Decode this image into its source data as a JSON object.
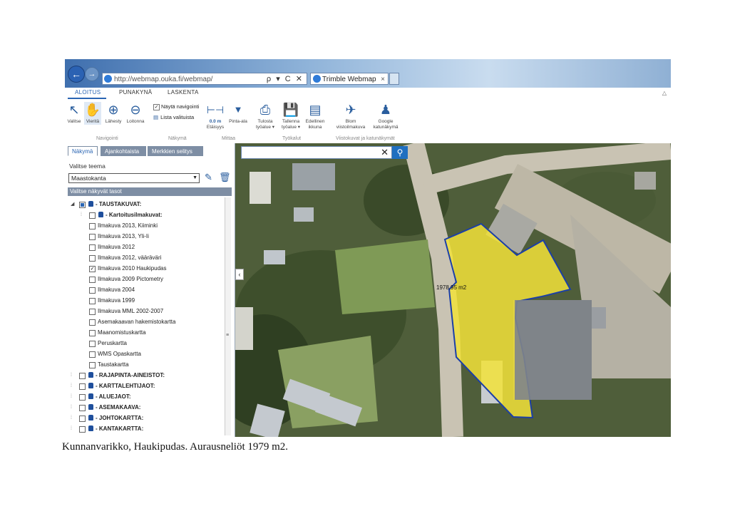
{
  "browser": {
    "url": "http://webmap.ouka.fi/webmap/",
    "tab_title": "Trimble Webmap",
    "tab_close": "×",
    "address_tools": "ρ ▾ C ✕"
  },
  "ribbon": {
    "tabs": [
      "ALOITUS",
      "PUNAKYNÄ",
      "LASKENTA"
    ],
    "navigointi": [
      "Valitse",
      "Vieritä",
      "Lähesty",
      "Loitonna"
    ],
    "nakyma_checks": [
      "Näytä navigointi",
      "Lista valituista"
    ],
    "mittaa": [
      "Etäisyys",
      "Pinta-ala"
    ],
    "etaisyys_value": "0.0 m",
    "pinta_ala_icon": "m²",
    "tyokalut": [
      "Tulosta työalue ▾",
      "Tallenna työalue ▾",
      "Edellinen ikkuna"
    ],
    "viistokuvat": [
      "Blom viistoilmakuva",
      "Google katunäkymä"
    ],
    "group_labels": [
      "Navigointi",
      "Näkymä",
      "Mittaa",
      "Työkalut",
      "Viistokuvat ja katunäkymät"
    ]
  },
  "panel": {
    "tabs": [
      "Näkymä",
      "Ajankohtaista",
      "Merkkien selitys"
    ],
    "theme_label": "Valitse teema",
    "theme_value": "Maastokanta",
    "layers_header": "Valitse näkyvät tasot",
    "tree": [
      {
        "label": "- TAUSTAKUVAT:",
        "level": 0,
        "expand": "◢",
        "checked": "partial",
        "lock": true,
        "bold": true
      },
      {
        "label": "- Kartoitusilmakuvat:",
        "level": 1,
        "expand": "",
        "checked": false,
        "lock": true,
        "bold": true
      },
      {
        "label": "Ilmakuva 2013, Kiiminki",
        "level": 2,
        "checked": false
      },
      {
        "label": "Ilmakuva 2013, Yli-Ii",
        "level": 2,
        "checked": false
      },
      {
        "label": "Ilmakuva 2012",
        "level": 2,
        "checked": false
      },
      {
        "label": "Ilmakuva 2012, vääräväri",
        "level": 2,
        "checked": false
      },
      {
        "label": "Ilmakuva 2010 Haukipudas",
        "level": 2,
        "checked": true
      },
      {
        "label": "Ilmakuva 2009 Pictometry",
        "level": 2,
        "checked": false
      },
      {
        "label": "Ilmakuva 2004",
        "level": 2,
        "checked": false
      },
      {
        "label": "Ilmakuva 1999",
        "level": 2,
        "checked": false
      },
      {
        "label": "Ilmakuva MML 2002-2007",
        "level": 2,
        "checked": false
      },
      {
        "label": "Asemakaavan hakemistokartta",
        "level": 2,
        "checked": false
      },
      {
        "label": "Maanomistuskartta",
        "level": 2,
        "checked": false
      },
      {
        "label": "Peruskartta",
        "level": 2,
        "checked": false
      },
      {
        "label": "WMS Opaskartta",
        "level": 2,
        "checked": false
      },
      {
        "label": "Taustakartta",
        "level": 2,
        "checked": false
      },
      {
        "label": "- RAJAPINTA-AINEISTOT:",
        "level": 0,
        "checked": false,
        "lock": true,
        "bold": true
      },
      {
        "label": "- KARTTALEHTIJAOT:",
        "level": 0,
        "checked": false,
        "lock": true,
        "bold": true
      },
      {
        "label": "- ALUEJAOT:",
        "level": 0,
        "checked": false,
        "lock": true,
        "bold": true
      },
      {
        "label": "- ASEMAKAAVA:",
        "level": 0,
        "checked": false,
        "lock": true,
        "bold": true
      },
      {
        "label": "- JOHTOKARTTA:",
        "level": 0,
        "checked": false,
        "lock": true,
        "bold": true
      },
      {
        "label": "- KANTAKARTTA:",
        "level": 0,
        "checked": false,
        "lock": true,
        "bold": true
      }
    ]
  },
  "map": {
    "search_clear": "✕",
    "area_label": "1978,95 m2",
    "collapse": "‹",
    "highlight_color": "#f2e23a",
    "outline_color": "#1b3fa8"
  },
  "caption": "Kunnanvarikko, Haukipudas. Aurausneliöt 1979 m2."
}
